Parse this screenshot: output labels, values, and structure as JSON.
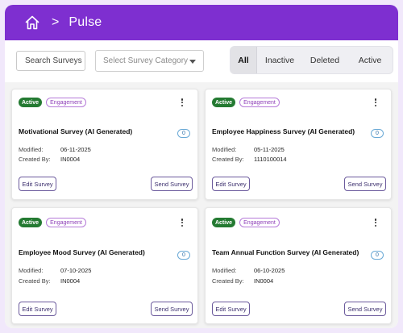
{
  "header": {
    "title": "Pulse",
    "separator": ">"
  },
  "search": {
    "placeholder": "Search Surveys"
  },
  "category": {
    "placeholder": "Select Survey Category"
  },
  "filters": [
    "All",
    "Inactive",
    "Deleted",
    "Active"
  ],
  "labels": {
    "modified": "Modified:",
    "created_by": "Created By:",
    "edit": "Edit Survey",
    "send": "Send Survey"
  },
  "cards": [
    {
      "status": "Active",
      "category": "Engagement",
      "title": "Motivational Survey (AI Generated)",
      "count": "0",
      "modified": "06-11-2025",
      "created_by": "IN0004"
    },
    {
      "status": "Active",
      "category": "Engagement",
      "title": "Employee Happiness Survey (AI Generated)",
      "count": "0",
      "modified": "05-11-2025",
      "created_by": "1110100014"
    },
    {
      "status": "Active",
      "category": "Engagement",
      "title": "Employee Mood Survey (AI Generated)",
      "count": "0",
      "modified": "07-10-2025",
      "created_by": "IN0004"
    },
    {
      "status": "Active",
      "category": "Engagement",
      "title": "Team Annual Function Survey (AI Generated)",
      "count": "0",
      "modified": "06-10-2025",
      "created_by": "IN0004"
    }
  ],
  "colors": {
    "header": "#7e2fd0",
    "active_badge": "#247a32",
    "tag_border": "#b57ad8",
    "count_border": "#6aa9d6"
  },
  "icons": {
    "home": "home-icon",
    "menu": "more-vertical-icon",
    "dropdown": "chevron-down-icon"
  }
}
